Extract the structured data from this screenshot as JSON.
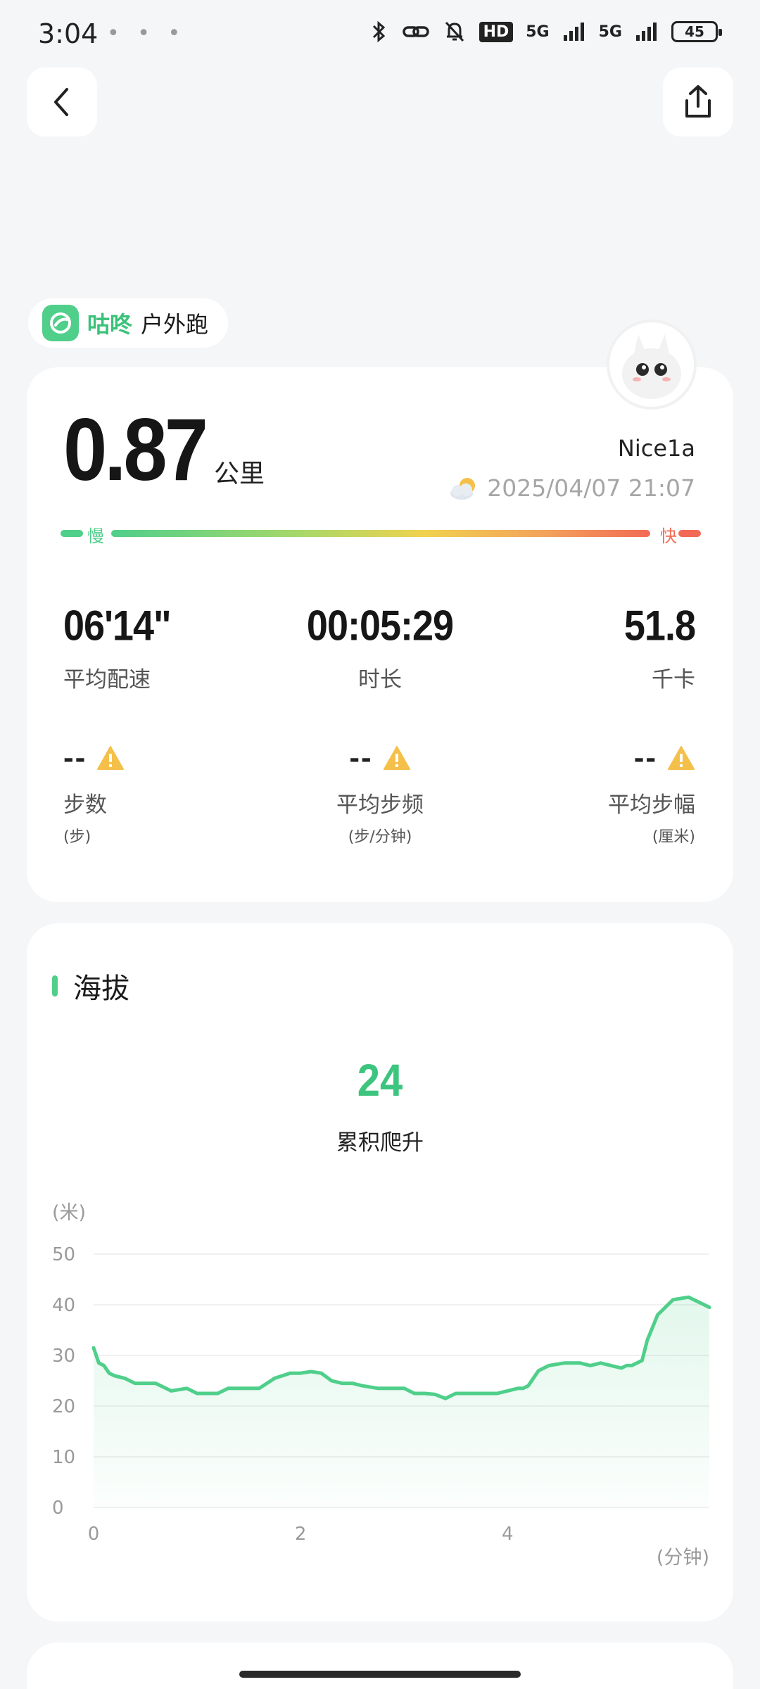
{
  "status_bar": {
    "time": "3:04",
    "extra": "• • •",
    "hd_label": "HD",
    "net1": "5G",
    "net2": "5G",
    "battery": "45"
  },
  "app_tag": {
    "brand": "咕咚",
    "activity_type": "户外跑"
  },
  "summary": {
    "distance": "0.87",
    "distance_unit": "公里",
    "username": "Nice1a",
    "datetime": "2025/04/07 21:07",
    "weather_icon": "cloudy-moon-icon",
    "pace_slow_label": "慢",
    "pace_fast_label": "快",
    "stats": [
      {
        "value": "06'14\"",
        "label": "平均配速"
      },
      {
        "value": "00:05:29",
        "label": "时长"
      },
      {
        "value": "51.8",
        "label": "千卡"
      }
    ],
    "stats2": [
      {
        "value": "--",
        "label": "步数",
        "unit": "(步)"
      },
      {
        "value": "--",
        "label": "平均步频",
        "unit": "(步/分钟)"
      },
      {
        "value": "--",
        "label": "平均步幅",
        "unit": "(厘米)"
      }
    ]
  },
  "elevation": {
    "title": "海拔",
    "climb_value": "24",
    "climb_label": "累积爬升"
  },
  "colors": {
    "accent": "#4fcf8a",
    "warning": "#f5c04a",
    "fast": "#f26a55"
  },
  "chart_data": {
    "type": "area",
    "ylabel": "(米)",
    "xlabel": "(分钟)",
    "y_ticks": [
      "50",
      "40",
      "30",
      "20",
      "10",
      "0"
    ],
    "x_ticks": [
      "0",
      "2",
      "4"
    ],
    "ylim": [
      0,
      50
    ],
    "xlim": [
      0,
      5.95
    ],
    "grid": true,
    "series": [
      {
        "x": [
          0,
          0.05,
          0.1,
          0.15,
          0.2,
          0.3,
          0.4,
          0.5,
          0.6,
          0.75,
          0.9,
          1.0,
          1.1,
          1.2,
          1.3,
          1.4,
          1.5,
          1.6,
          1.75,
          1.9,
          2.0,
          2.1,
          2.2,
          2.3,
          2.4,
          2.5,
          2.6,
          2.75,
          2.9,
          3.0,
          3.1,
          3.2,
          3.3,
          3.4,
          3.5,
          3.6,
          3.75,
          3.9,
          4.0,
          4.1,
          4.15,
          4.2,
          4.3,
          4.4,
          4.55,
          4.7,
          4.8,
          4.9,
          5.0,
          5.1,
          5.15,
          5.2,
          5.25,
          5.3,
          5.35,
          5.45,
          5.6,
          5.75,
          5.85,
          5.95
        ],
        "y": [
          31.5,
          28.5,
          28,
          26.5,
          26,
          25.5,
          24.5,
          24.5,
          24.5,
          23,
          23.5,
          22.5,
          22.5,
          22.5,
          23.5,
          23.5,
          23.5,
          23.5,
          25.5,
          26.5,
          26.5,
          26.8,
          26.5,
          25,
          24.5,
          24.5,
          24,
          23.5,
          23.5,
          23.5,
          22.5,
          22.5,
          22.3,
          21.5,
          22.5,
          22.5,
          22.5,
          22.5,
          23,
          23.5,
          23.5,
          24,
          27,
          28,
          28.5,
          28.5,
          28,
          28.5,
          28,
          27.5,
          28,
          28,
          28.5,
          29,
          33,
          38,
          41,
          41.5,
          40.5,
          39.5
        ]
      }
    ]
  }
}
